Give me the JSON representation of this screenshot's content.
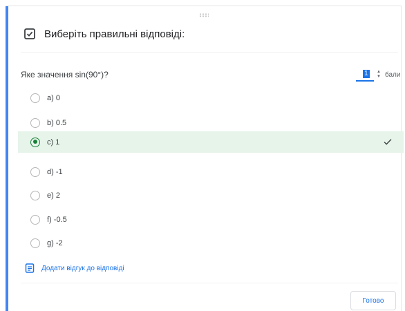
{
  "header": {
    "title": "Виберіть правильні відповіді:",
    "icon": "checkbox-checked-icon"
  },
  "question": {
    "text": "Яке значення sin(90°)?",
    "points_value": "1",
    "points_label": "бали",
    "spinner_up": "▲",
    "spinner_down": "▼"
  },
  "options": [
    {
      "label": "a) 0",
      "selected": false
    },
    {
      "label": "b) 0.5",
      "selected": false
    },
    {
      "label": "c) 1",
      "selected": true
    },
    {
      "label": "d) -1",
      "selected": false
    },
    {
      "label": "e) 2",
      "selected": false
    },
    {
      "label": "f) -0.5",
      "selected": false
    },
    {
      "label": "g) -2",
      "selected": false
    }
  ],
  "feedback": {
    "label": "Додати відгук до відповіді",
    "icon": "feedback-icon"
  },
  "footer": {
    "done_label": "Готово"
  },
  "colors": {
    "accent": "#4285f4",
    "primary": "#1a73e8",
    "correct": "#188038",
    "correct_bg": "#e6f4ea"
  }
}
